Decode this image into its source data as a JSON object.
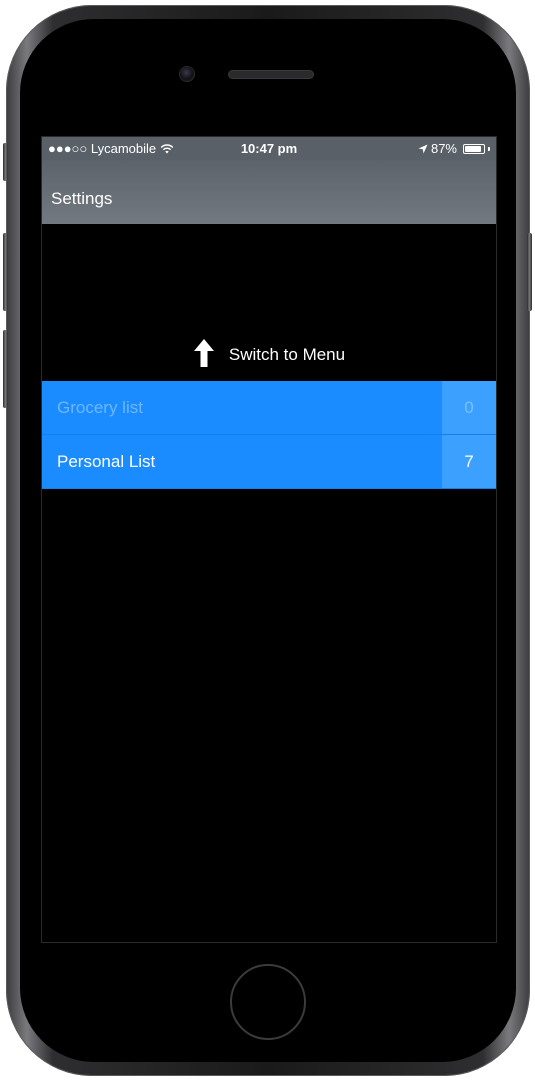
{
  "status_bar": {
    "carrier": "●●●○○ Lycamobile",
    "time": "10:47 pm",
    "battery_percent": "87%",
    "battery_level": 0.87,
    "icons": [
      "wifi-icon",
      "location-arrow-icon",
      "battery-icon"
    ]
  },
  "navbar": {
    "title": "Settings"
  },
  "switch": {
    "label": "Switch to Menu",
    "icon": "arrow-up-icon"
  },
  "lists": [
    {
      "name": "Grocery list",
      "count": "0"
    },
    {
      "name": "Personal List",
      "count": "7"
    }
  ],
  "colors": {
    "accent": "#1a8cff",
    "count_bg": "#3ba0ff",
    "navbar": "#6b7178",
    "background": "#000000"
  }
}
